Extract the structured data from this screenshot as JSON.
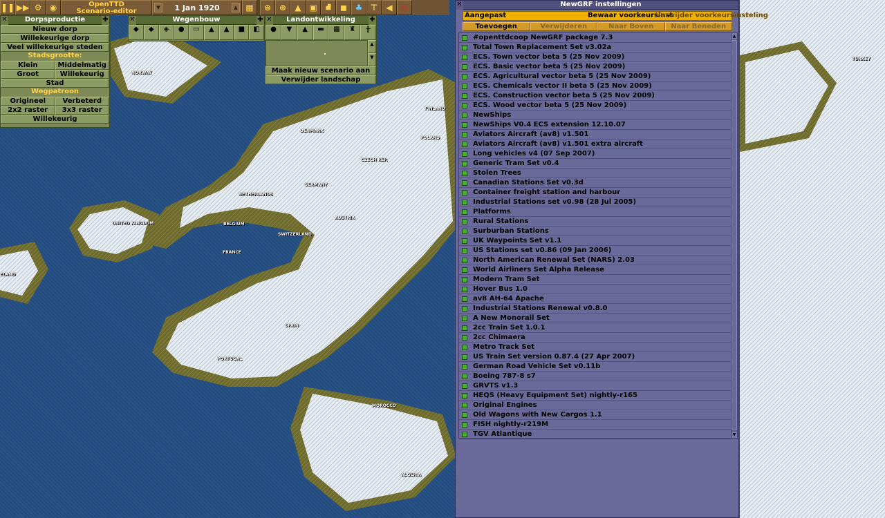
{
  "toolbar": {
    "title_line1": "OpenTTD",
    "title_line2": "Scenario-editor",
    "date": "1 Jan 1920"
  },
  "town_window": {
    "title": "Dorpsproductie",
    "new_town": "Nieuw dorp",
    "random_town": "Willekeurige dorp",
    "many_random": "Veel willekeurige steden",
    "size_header": "Stadsgrootte:",
    "size_small": "Klein",
    "size_medium": "Middelmatig",
    "size_large": "Groot",
    "size_random": "Willekeurig",
    "city": "Stad",
    "layout_header": "Wegpatroon",
    "layout_original": "Origineel",
    "layout_better": "Verbeterd",
    "layout_2x2": "2x2 raster",
    "layout_3x3": "3x3 raster",
    "layout_random": "Willekeurig"
  },
  "road_window": {
    "title": "Wegenbouw"
  },
  "land_window": {
    "title": "Landontwikkeling",
    "new_scenario": "Maak nieuw scenario aan",
    "remove_land": "Verwijder landschap"
  },
  "newgrf": {
    "title": "NewGRF instellingen",
    "preset_value": "Aangepast",
    "save_preset": "Bewaar voorkeursinst",
    "delete_preset": "Verwijder voorkeursinsteling",
    "add": "Toevoegen",
    "remove": "Verwijderen",
    "move_up": "Naar Boven",
    "move_down": "Naar Beneden",
    "items": [
      "#openttdcoop NewGRF package 7.3",
      "Total Town Replacement Set v3.02a",
      "ECS. Town vector beta 5 (25 Nov 2009)",
      "ECS. Basic vector beta 5 (25 Nov 2009)",
      "ECS. Agricultural vector beta 5 (25 Nov 2009)",
      "ECS. Chemicals vector II beta 5 (25 Nov 2009)",
      "ECS. Construction vector beta 5 (25 Nov 2009)",
      "ECS. Wood vector beta 5 (25 Nov 2009)",
      "NewShips",
      "NewShips V0.4 ECS extension 12.10.07",
      "Aviators Aircraft (av8) v1.501",
      "Aviators Aircraft (av8) v1.501 extra aircraft",
      "Long vehicles v4 (07 Sep 2007)",
      "Generic Tram Set v0.4",
      "Stolen Trees",
      "Canadian Stations Set v0.3d",
      "Container freight station and harbour",
      "Industrial Stations set v0.98 (28 Jul 2005)",
      "Platforms",
      "Rural Stations",
      "Surburban Stations",
      "UK Waypoints Set v1.1",
      "US Stations set v0.86 (09 Jan 2006)",
      "North American Renewal Set (NARS) 2.03",
      "World Airliners Set Alpha Release",
      "Modern Tram Set",
      "Hover Bus 1.0",
      "av8 AH-64 Apache",
      "Industrial Stations Renewal v0.8.0",
      "A New Monorail Set",
      "2cc Train Set 1.0.1",
      "2cc Chimaera",
      "Metro Track Set",
      "US Train Set version 0.87.4 (27 Apr 2007)",
      "German Road Vehicle Set v0.11b",
      "Boeing 787-8 s7",
      "GRVTS v1.3",
      "HEQS (Heavy Equipment Set) nightly-r165",
      "Original Engines",
      "Old Wagons with New Cargos 1.1",
      "FISH nightly-r219M",
      "TGV Atlantique"
    ]
  },
  "map_labels": {
    "uk": "UNITED KINGDOM",
    "ireland": "ELAND",
    "netherlands": "NETHERLANDS",
    "belgium": "BELGIUM",
    "france": "FRANCE",
    "switzerland": "SWITZERLAND",
    "germany": "GERMANY",
    "austria": "AUSTRIA",
    "czech": "CZECH REP.",
    "denmark": "DENMARK",
    "spain": "SPAIN",
    "portugal": "PORTUGAL",
    "morocco": "MOROCCO",
    "finland": "FINLAND",
    "turkey": "TURKEY",
    "poland": "POLAND",
    "norway": "NORWAY",
    "algeria": "ALGERIA"
  }
}
